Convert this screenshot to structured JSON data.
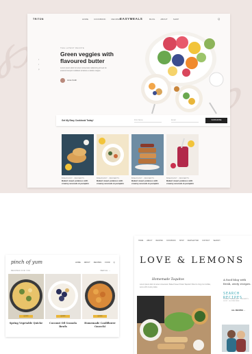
{
  "top_mockup": {
    "logo": "TRITON",
    "nav_left": [
      "HOME",
      "COOKBOOK",
      "RECIPES"
    ],
    "brand": "EASYMEALS",
    "nav_right": [
      "BLOG",
      "ABOUT",
      "SHOP"
    ],
    "search": "Q",
    "hero_kicker": "THE LATEST RECIPE",
    "hero_title": "Green veggies with flavoured butter",
    "hero_desc": "Lorem ipsum dolor sit amet consectetur adipiscing elit sed do eiusmod tempor incididunt ut labore et dolore magna",
    "share": [
      "f",
      "t",
      "p"
    ],
    "author": "Annie Smith",
    "signup_label": "Get My Easy Cookbook Today!",
    "signup_field1": "First Name",
    "signup_field2": "Email",
    "signup_button": "SUBSCRIBE",
    "recipes": [
      {
        "cat": "BREAKFAST · DESSERTS",
        "title": "Baked sweet potatoes with creamy avocado & pumpkin"
      },
      {
        "cat": "BREAKFAST · DESSERTS",
        "title": "Baked sweet potatoes with creamy avocado & pumpkin"
      },
      {
        "cat": "BREAKFAST · DESSERTS",
        "title": "Baked sweet potatoes with creamy avocado & pumpkin"
      },
      {
        "cat": "BREAKFAST · DESSERTS",
        "title": "Baked sweet potatoes with creamy avocado & pumpkin"
      }
    ]
  },
  "pinch_site": {
    "logo": "pinch of yum",
    "nav": [
      "HOME",
      "ABOUT",
      "RECIPES",
      "FOOD",
      "Q"
    ],
    "heading": "RECIPES FOR YOU",
    "view_all": "VIEW ALL →",
    "cards": [
      {
        "badge": "QUICK",
        "title": "Spring Vegetable Quiche"
      },
      {
        "badge": "QUICK",
        "title": "Coconut Oil Granola Bowls"
      },
      {
        "badge": "QUICK",
        "title": "Homemade Cauliflower Gnocchi"
      }
    ]
  },
  "love_lemons": {
    "nav": [
      "HOME",
      "ABOUT",
      "RECIPES",
      "COOKBOOK",
      "SHOP",
      "NEWSLETTER",
      "CONTACT",
      "SEARCH"
    ],
    "logo": "LOVE & LEMONS",
    "subtitle": "Homemade Taquitos",
    "desc": "Lorem ipsum dolor sit amet consectetur. Baked Sweet Potato Taquitos! Filled in crispy fun tortillas, serve with creamy salsa.",
    "side_text": "A food blog with fresh, zesty recipes.",
    "side_search": "SEARCH RECIPES",
    "side_tags": "DINNER · BREAKFAST · DESSERTS · SOUP · GLUTEN FREE",
    "side_all": "ALL RECIPES →"
  },
  "colors": {
    "bg_top": "#efe6e3",
    "accent_yellow": "#e9b63a",
    "teal": "#3aa7b5"
  }
}
